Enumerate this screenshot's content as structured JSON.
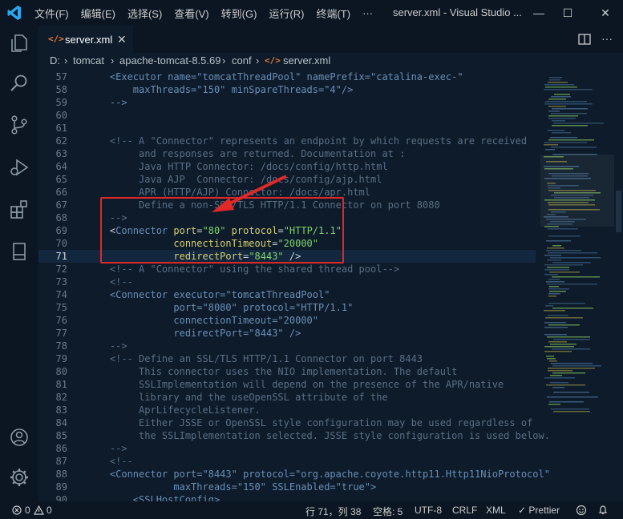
{
  "titlebar": {
    "menu": [
      "文件(F)",
      "编辑(E)",
      "选择(S)",
      "查看(V)",
      "转到(G)",
      "运行(R)",
      "终端(T)"
    ],
    "more": "···",
    "window_title": "server.xml - Visual Studio ...",
    "minimize": "—",
    "maximize": "☐",
    "close": "✕"
  },
  "tab": {
    "icon_text": "</>",
    "name": "server.xml",
    "close": "✕"
  },
  "breadcrumb": [
    "D:",
    "tomcat",
    "apache-tomcat-8.5.69",
    "conf",
    "server.xml"
  ],
  "breadcrumb_icon": "</>",
  "breadcrumb_sep": "›",
  "code_lines": [
    {
      "n": "57",
      "segs": [
        [
          "t",
          "    <Executor name=\"tomcatThreadPool\" namePrefix=\"catalina-exec-\""
        ]
      ]
    },
    {
      "n": "58",
      "segs": [
        [
          "t",
          "        maxThreads=\"150\" minSpareThreads=\"4\"/>"
        ]
      ]
    },
    {
      "n": "59",
      "segs": [
        [
          "t",
          "    -->"
        ]
      ]
    },
    {
      "n": "60",
      "segs": []
    },
    {
      "n": "61",
      "segs": []
    },
    {
      "n": "62",
      "segs": [
        [
          "c",
          "    <!-- A \"Connector\" represents an endpoint by which requests are received"
        ]
      ]
    },
    {
      "n": "63",
      "segs": [
        [
          "c",
          "         and responses are returned. Documentation at :"
        ]
      ]
    },
    {
      "n": "64",
      "segs": [
        [
          "c",
          "         Java HTTP Connector: /docs/config/http.html"
        ]
      ]
    },
    {
      "n": "65",
      "segs": [
        [
          "c",
          "         Java AJP  Connector: /docs/config/ajp.html"
        ]
      ]
    },
    {
      "n": "66",
      "segs": [
        [
          "c",
          "         APR (HTTP/AJP) Connector: /docs/apr.html"
        ]
      ]
    },
    {
      "n": "67",
      "segs": [
        [
          "c",
          "         Define a non-SSL/TLS HTTP/1.1 Connector on port 8080"
        ]
      ]
    },
    {
      "n": "68",
      "segs": [
        [
          "c",
          "    -->"
        ]
      ]
    },
    {
      "n": "69",
      "segs": [
        [
          "p",
          "    <"
        ],
        [
          "t",
          "Connector "
        ],
        [
          "a",
          "port"
        ],
        [
          "p",
          "="
        ],
        [
          "v",
          "\"80\""
        ],
        [
          "p",
          " "
        ],
        [
          "a",
          "protocol"
        ],
        [
          "p",
          "="
        ],
        [
          "v",
          "\"HTTP/1.1\""
        ]
      ]
    },
    {
      "n": "70",
      "segs": [
        [
          "p",
          "               "
        ],
        [
          "a",
          "connectionTimeout"
        ],
        [
          "p",
          "="
        ],
        [
          "v",
          "\"20000\""
        ]
      ]
    },
    {
      "n": "71",
      "segs": [
        [
          "p",
          "               "
        ],
        [
          "a",
          "redirectPort"
        ],
        [
          "p",
          "="
        ],
        [
          "v",
          "\"8443\""
        ],
        [
          "p",
          " />"
        ]
      ]
    },
    {
      "n": "72",
      "segs": [
        [
          "c",
          "    <!-- A \"Connector\" using the shared thread pool-->"
        ]
      ]
    },
    {
      "n": "73",
      "segs": [
        [
          "c",
          "    <!--"
        ]
      ]
    },
    {
      "n": "74",
      "segs": [
        [
          "t",
          "    <Connector executor=\"tomcatThreadPool\""
        ]
      ]
    },
    {
      "n": "75",
      "segs": [
        [
          "t",
          "               port=\"8080\" protocol=\"HTTP/1.1\""
        ]
      ]
    },
    {
      "n": "76",
      "segs": [
        [
          "t",
          "               connectionTimeout=\"20000\""
        ]
      ]
    },
    {
      "n": "77",
      "segs": [
        [
          "t",
          "               redirectPort=\"8443\" />"
        ]
      ]
    },
    {
      "n": "78",
      "segs": [
        [
          "c",
          "    -->"
        ]
      ]
    },
    {
      "n": "79",
      "segs": [
        [
          "c",
          "    <!-- Define an SSL/TLS HTTP/1.1 Connector on port 8443"
        ]
      ]
    },
    {
      "n": "80",
      "segs": [
        [
          "c",
          "         This connector uses the NIO implementation. The default"
        ]
      ]
    },
    {
      "n": "81",
      "segs": [
        [
          "c",
          "         SSLImplementation will depend on the presence of the APR/native"
        ]
      ]
    },
    {
      "n": "82",
      "segs": [
        [
          "c",
          "         library and the useOpenSSL attribute of the"
        ]
      ]
    },
    {
      "n": "83",
      "segs": [
        [
          "c",
          "         AprLifecycleListener."
        ]
      ]
    },
    {
      "n": "84",
      "segs": [
        [
          "c",
          "         Either JSSE or OpenSSL style configuration may be used regardless of"
        ]
      ]
    },
    {
      "n": "85",
      "segs": [
        [
          "c",
          "         the SSLImplementation selected. JSSE style configuration is used below."
        ]
      ]
    },
    {
      "n": "86",
      "segs": [
        [
          "c",
          "    -->"
        ]
      ]
    },
    {
      "n": "87",
      "segs": [
        [
          "c",
          "    <!--"
        ]
      ]
    },
    {
      "n": "88",
      "segs": [
        [
          "t",
          "    <Connector port=\"8443\" protocol=\"org.apache.coyote.http11.Http11NioProtocol\""
        ]
      ]
    },
    {
      "n": "89",
      "segs": [
        [
          "t",
          "               maxThreads=\"150\" SSLEnabled=\"true\">"
        ]
      ]
    },
    {
      "n": "90",
      "segs": [
        [
          "t",
          "        <SSLHostConfig>"
        ]
      ]
    }
  ],
  "current_line": "71",
  "status": {
    "errors": "0",
    "warnings": "0",
    "position": "行 71，列 38",
    "spaces": "空格: 5",
    "encoding": "UTF-8",
    "eol": "CRLF",
    "language": "XML",
    "prettier": "✓ Prettier"
  },
  "colors": {
    "accent_blue": "#007acc",
    "highlight_box": "#e02828"
  }
}
